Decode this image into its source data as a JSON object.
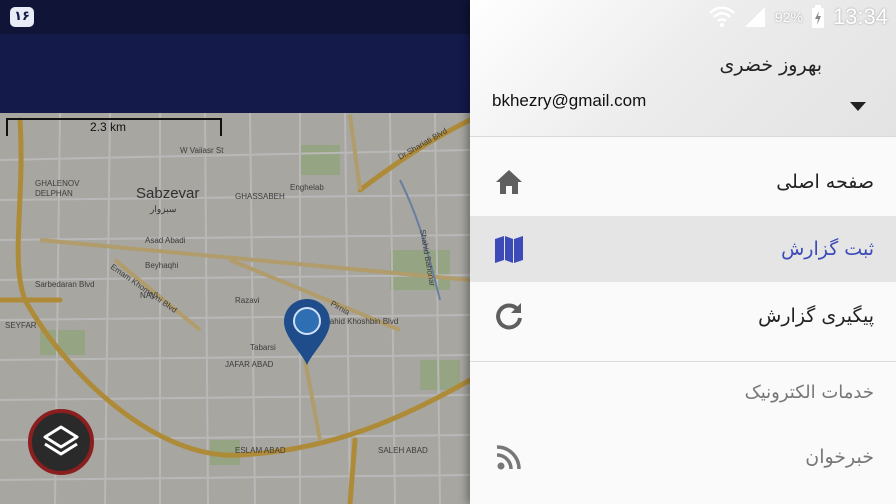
{
  "map": {
    "notification_badge": "۱۶",
    "scale_label": "2.3 km",
    "labels": [
      "W Vaiiasr St",
      "Sabzevar",
      "سبزوار",
      "GHASSABEH",
      "Enghelab",
      "Dr.Shariati Blvd",
      "GHALENOV",
      "DELPHAN",
      "Asad Abadi",
      "Beyhaqhi",
      "Sarbedaran Blvd",
      "Emam Khomeyni Blvd",
      "NAVI",
      "Razavi",
      "Pirnia",
      "Tabarsi",
      "JAFAR ABAD",
      "SEYFAR",
      "ESLAM ABAD",
      "SALEH ABAD",
      "Shahid Khoshbin Blvd",
      "Shahid Bahonar"
    ]
  },
  "drawer": {
    "status": {
      "battery": "92%",
      "time": "13:34"
    },
    "account": {
      "name": "بهروز خضری",
      "email": "bkhezry@gmail.com"
    },
    "items": [
      {
        "label": "صفحه اصلی",
        "icon": "home-icon",
        "active": false
      },
      {
        "label": "ثبت گزارش",
        "icon": "map-icon",
        "active": true
      },
      {
        "label": "پیگیری گزارش",
        "icon": "refresh-icon",
        "active": false
      }
    ],
    "section": {
      "title": "خدمات الکترونیک"
    },
    "section_items": [
      {
        "label": "خبرخوان",
        "icon": "rss-feed-icon"
      }
    ]
  },
  "colors": {
    "appbar": "#141a4a",
    "active_text": "#3c4bb8",
    "pin": "#1f4d8c",
    "layers_ring": "#8b1f1f"
  }
}
